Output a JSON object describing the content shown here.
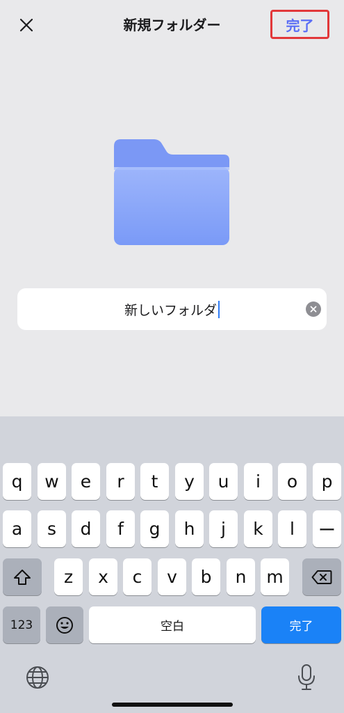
{
  "nav": {
    "close_icon": "close-icon",
    "title": "新規フォルダー",
    "done_label": "完了"
  },
  "folder": {
    "icon": "folder-icon",
    "color": "#7e9ef8"
  },
  "name_field": {
    "value": "新しいフォルダ",
    "clear_icon": "clear-icon"
  },
  "keyboard": {
    "row1": [
      "q",
      "w",
      "e",
      "r",
      "t",
      "y",
      "u",
      "i",
      "o",
      "p"
    ],
    "row2": [
      "a",
      "s",
      "d",
      "f",
      "g",
      "h",
      "j",
      "k",
      "l",
      "ー"
    ],
    "row3": [
      "z",
      "x",
      "c",
      "v",
      "b",
      "n",
      "m"
    ],
    "shift_icon": "shift-icon",
    "delete_icon": "delete-icon",
    "numbers_label": "123",
    "emoji_icon": "emoji-icon",
    "space_label": "空白",
    "return_label": "完了",
    "globe_icon": "globe-icon",
    "mic_icon": "microphone-icon",
    "accent_color": "#1a82f7"
  }
}
